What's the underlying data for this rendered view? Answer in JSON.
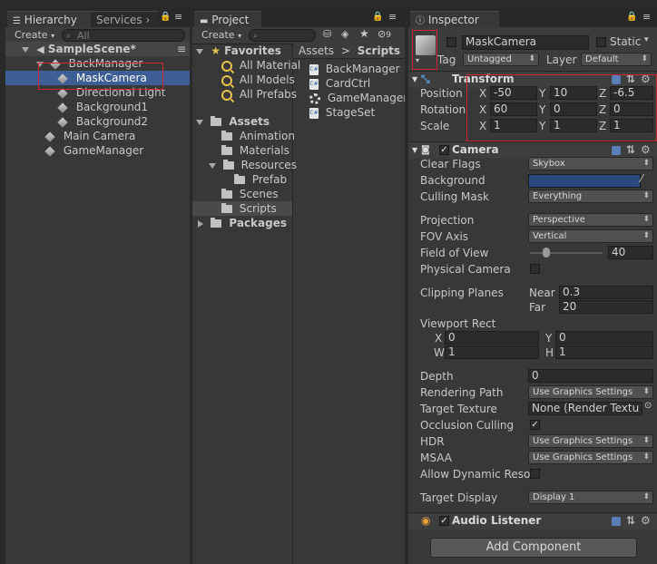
{
  "hierarchy": {
    "tab_label": "Hierarchy",
    "services_label": "Services",
    "create_label": "Create",
    "search_placeholder": "All",
    "scene_name": "SampleScene*",
    "items": [
      {
        "label": "BackManager"
      },
      {
        "label": "MaskCamera"
      },
      {
        "label": "Directional Light"
      },
      {
        "label": "Background1"
      },
      {
        "label": "Background2"
      },
      {
        "label": "Main Camera"
      },
      {
        "label": "GameManager"
      }
    ]
  },
  "project": {
    "tab_label": "Project",
    "create_label": "Create",
    "count_badge": "9",
    "favorites": {
      "label": "Favorites",
      "items": [
        "All Material",
        "All Models",
        "All Prefabs"
      ]
    },
    "assets": {
      "label": "Assets",
      "items": [
        "Animation",
        "Materials",
        "Resources",
        "Prefab",
        "Scenes",
        "Scripts"
      ]
    },
    "packages_label": "Packages",
    "breadcrumb": {
      "root": "Assets",
      "separator": ">",
      "current": "Scripts"
    },
    "files": [
      "BackManager",
      "CardCtrl",
      "GameManager",
      "StageSet"
    ]
  },
  "inspector": {
    "tab_label": "Inspector",
    "object_name": "MaskCamera",
    "static_label": "Static",
    "tag_label": "Tag",
    "tag_value": "Untagged",
    "layer_label": "Layer",
    "layer_value": "Default",
    "transform": {
      "title": "Transform",
      "position_label": "Position",
      "rotation_label": "Rotation",
      "scale_label": "Scale",
      "axis_x": "X",
      "axis_y": "Y",
      "axis_z": "Z",
      "position": {
        "x": "-50",
        "y": "10",
        "z": "-6.5"
      },
      "rotation": {
        "x": "60",
        "y": "0",
        "z": "0"
      },
      "scale": {
        "x": "1",
        "y": "1",
        "z": "1"
      }
    },
    "camera": {
      "title": "Camera",
      "clear_flags_label": "Clear Flags",
      "clear_flags_value": "Skybox",
      "background_label": "Background",
      "background_color": "#2a4a7f",
      "culling_mask_label": "Culling Mask",
      "culling_mask_value": "Everything",
      "projection_label": "Projection",
      "projection_value": "Perspective",
      "fov_axis_label": "FOV Axis",
      "fov_axis_value": "Vertical",
      "fov_label": "Field of View",
      "fov_value": "40",
      "physical_camera_label": "Physical Camera",
      "clipping_label": "Clipping Planes",
      "near_label": "Near",
      "near_value": "0.3",
      "far_label": "Far",
      "far_value": "20",
      "viewport_label": "Viewport Rect",
      "vp_x_label": "X",
      "vp_x": "0",
      "vp_y_label": "Y",
      "vp_y": "0",
      "vp_w_label": "W",
      "vp_w": "1",
      "vp_h_label": "H",
      "vp_h": "1",
      "depth_label": "Depth",
      "depth_value": "0",
      "rendering_path_label": "Rendering Path",
      "rendering_path_value": "Use Graphics Settings",
      "target_texture_label": "Target Texture",
      "target_texture_value": "None (Render Textu",
      "occlusion_label": "Occlusion Culling",
      "hdr_label": "HDR",
      "hdr_value": "Use Graphics Settings",
      "msaa_label": "MSAA",
      "msaa_value": "Use Graphics Settings",
      "dynamic_res_label": "Allow Dynamic Resol",
      "target_display_label": "Target Display",
      "target_display_value": "Display 1"
    },
    "audio_listener_title": "Audio Listener",
    "add_component_label": "Add Component"
  },
  "colors": {
    "selection": "#3e5f96",
    "highlight_box": "#d0262e",
    "accent_orange": "#e8a33a"
  }
}
